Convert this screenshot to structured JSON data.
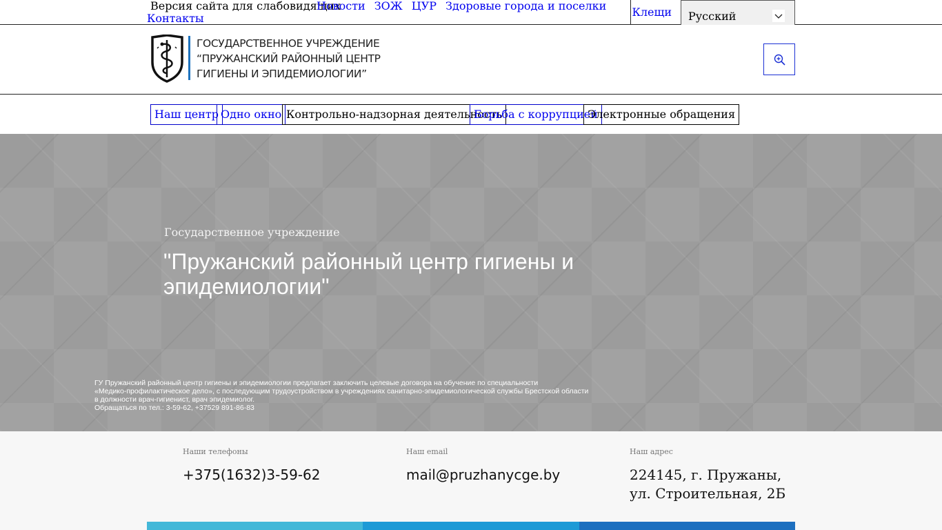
{
  "topbar": {
    "vision_label": "Версия сайта для слабовидящих",
    "links": [
      "Новости",
      "ЗОЖ",
      "ЦУР",
      "Здоровые города и поселки"
    ],
    "contacts_label": "Контакты",
    "city_label": "Клещи",
    "language": {
      "selected": "Русский",
      "icon": "chevron-down-icon"
    }
  },
  "header": {
    "logo_lines": [
      "ГОСУДАРСТВЕННОЕ УЧРЕЖДЕНИЕ",
      "“ПРУЖАНСКИЙ РАЙОННЫЙ ЦЕНТР",
      "ГИГИЕНЫ И ЭПИДЕМИОЛОГИИ”"
    ],
    "logo_icon": "emblem-serpent-shield-icon",
    "search_icon": "zoom-in-icon",
    "accent_color": "#1e73be"
  },
  "nav": {
    "items": [
      {
        "label": "Наш центр"
      },
      {
        "label": "Одно окно"
      },
      {
        "label": "Контрольно-надзорная деятельность"
      },
      {
        "label": "Борьба с коррупцией"
      },
      {
        "label": "Электронные обращения"
      }
    ]
  },
  "hero": {
    "subtitle": "Государственное учреждение",
    "title": "\"Пружанский районный центр гигиены и эпидемиологии\"",
    "notice_lines": [
      "ГУ Пружанский районный центр гигиены и эпидемиологии предлагает заключить целевые договора на обучение по специальности",
      "«Медико-профилактическое дело», с последующим трудоустройством в учреждениях санитарно-эпидемиологической службы Брестской области",
      "в должности врач-гигиенист, врач эпидемиолог.",
      "Обращаться по тел.: 3-59-62, +37529 891-86-83"
    ]
  },
  "contacts": {
    "phones_label": "Наши телефоны",
    "phones_value": "+375(1632)3-59-62",
    "email_label": "Наш email",
    "email_value": "mail@pruzhanycge.by",
    "address_label": "Наш адрес",
    "address_value": "224145, г. Пружаны, ул. Строительная, 2Б",
    "bar_colors": [
      "#44b8d8",
      "#1e9ad6",
      "#1d6fbf"
    ]
  }
}
